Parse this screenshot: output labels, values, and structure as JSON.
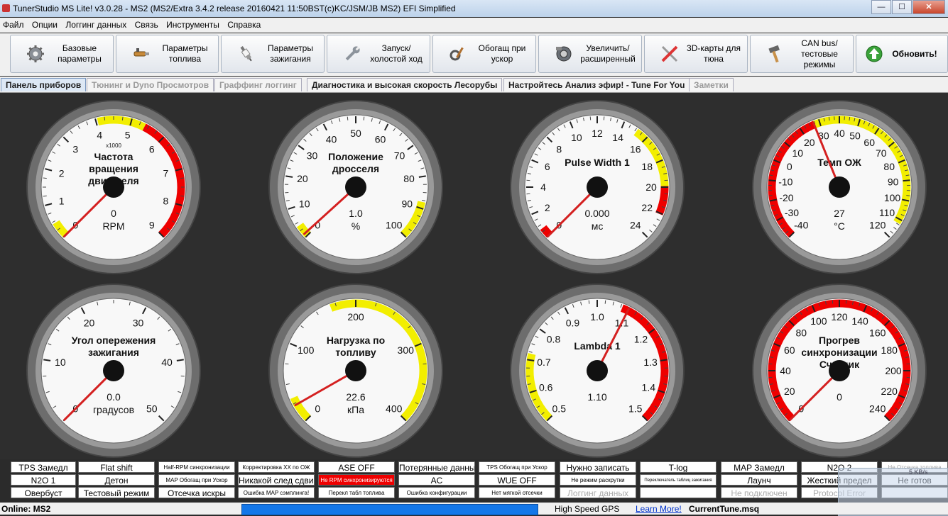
{
  "window": {
    "title": "TunerStudio MS Lite! v3.0.28 - MS2 (MS2/Extra 3.4.2 release  20160421 11:50BST(c)KC/JSM/JB   MS2) EFI Simplified",
    "min": "—",
    "max": "☐",
    "close": "✕"
  },
  "menu": [
    "Файл",
    "Опции",
    "Логгинг данных",
    "Связь",
    "Инструменты",
    "Справка"
  ],
  "toolbar": [
    {
      "label": "Базовые параметры",
      "icon": "gear-icon"
    },
    {
      "label": "Параметры топлива",
      "icon": "injector-icon"
    },
    {
      "label": "Параметры зажигания",
      "icon": "spark-plug-icon"
    },
    {
      "label": "Запуск/ холостой ход",
      "icon": "wrench-icon"
    },
    {
      "label": "Обогащ при ускор",
      "icon": "tools-icon"
    },
    {
      "label": "Увеличить/ расширенный",
      "icon": "turbo-icon"
    },
    {
      "label": "3D-карты для тюна",
      "icon": "screwdriver-icon"
    },
    {
      "label": "CAN bus/ тестовые режимы",
      "icon": "hammer-icon"
    },
    {
      "label": "Обновить!",
      "icon": "update-arrow-icon"
    }
  ],
  "tabs": [
    {
      "label": "Панель приборов",
      "state": "active"
    },
    {
      "label": "Тюнинг и Dyno Просмотров",
      "state": "dim"
    },
    {
      "label": "Граффинг логгинг",
      "state": "dim"
    },
    {
      "label": "Диагностика и высокая скорость Лесорубы",
      "state": "normal"
    },
    {
      "label": "Настройтесь Анализ эфир! - Tune For You",
      "state": "normal"
    },
    {
      "label": "Заметки",
      "state": "dim"
    }
  ],
  "gauges": [
    {
      "title": "Частота вращения двигателя",
      "value": "0",
      "units": "RPM",
      "mult": "x1000",
      "ticks": [
        "0",
        "1",
        "2",
        "3",
        "4",
        "5",
        "6",
        "7",
        "8",
        "9"
      ],
      "min": 0,
      "max": 9,
      "needle": 0
    },
    {
      "title": "Положение дросселя",
      "value": "1.0",
      "units": "%",
      "mult": "",
      "ticks": [
        "0",
        "10",
        "20",
        "30",
        "40",
        "50",
        "60",
        "70",
        "80",
        "90",
        "100"
      ],
      "min": 0,
      "max": 100,
      "needle": 1.0
    },
    {
      "title": "Pulse Width 1",
      "value": "0.000",
      "units": "мс",
      "mult": "",
      "ticks": [
        "0",
        "2",
        "4",
        "6",
        "8",
        "10",
        "12",
        "14",
        "16",
        "18",
        "20",
        "22",
        "24"
      ],
      "min": 0,
      "max": 24,
      "needle": 0
    },
    {
      "title": "Темп ОЖ",
      "value": "27",
      "units": "°C",
      "mult": "",
      "ticks": [
        "-40",
        "-30",
        "-20",
        "-10",
        "0",
        "10",
        "20",
        "30",
        "40",
        "50",
        "60",
        "70",
        "80",
        "90",
        "100",
        "110",
        "120"
      ],
      "min": -40,
      "max": 120,
      "needle": 27
    },
    {
      "title": "Угол опережения зажигания",
      "value": "0.0",
      "units": "градусов",
      "mult": "",
      "ticks": [
        "0",
        "10",
        "20",
        "30",
        "40",
        "50"
      ],
      "min": 0,
      "max": 50,
      "needle": 0
    },
    {
      "title": "Нагрузка по топливу",
      "value": "22.6",
      "units": "кПа",
      "mult": "",
      "ticks": [
        "0",
        "100",
        "200",
        "300",
        "400"
      ],
      "min": 0,
      "max": 400,
      "needle": 22.6
    },
    {
      "title": "Lambda 1",
      "value": "1.10",
      "units": "",
      "mult": "",
      "ticks": [
        "0.5",
        "0.6",
        "0.7",
        "0.8",
        "0.9",
        "1.0",
        "1.1",
        "1.2",
        "1.3",
        "1.4",
        "1.5"
      ],
      "min": 0.5,
      "max": 1.5,
      "needle": 1.1
    },
    {
      "title": "Прогрев синхронизации Счетчик",
      "value": "0",
      "units": "",
      "mult": "",
      "ticks": [
        "0",
        "20",
        "40",
        "60",
        "80",
        "100",
        "120",
        "140",
        "160",
        "180",
        "200",
        "220",
        "240"
      ],
      "min": 0,
      "max": 240,
      "needle": 0
    }
  ],
  "indicator_rows": [
    [
      {
        "label": "TPS Замедл",
        "style": "normal"
      },
      {
        "label": "Flat shift",
        "style": "normal"
      },
      {
        "label": "Half-RPM синхронизации",
        "style": "small"
      },
      {
        "label": "Корректировка ХХ по ОЖ",
        "style": "small"
      },
      {
        "label": "ASE OFF",
        "style": "normal"
      },
      {
        "label": "Потерянные данные",
        "style": "normal"
      },
      {
        "label": "TPS Обогащ при Ускор",
        "style": "small"
      },
      {
        "label": "Нужно записать",
        "style": "normal"
      },
      {
        "label": "T-log",
        "style": "normal"
      },
      {
        "label": "MAP Замедл",
        "style": "normal"
      },
      {
        "label": "N2O 2",
        "style": "normal"
      },
      {
        "label": "Не Отсечка топлива",
        "style": "small-dim"
      }
    ],
    [
      {
        "label": "N2O 1",
        "style": "normal"
      },
      {
        "label": "Детон",
        "style": "normal"
      },
      {
        "label": "MAP Обогащ при Ускор",
        "style": "small"
      },
      {
        "label": "Никакой след сдвиг",
        "style": "normal"
      },
      {
        "label": "Не RPM синхронизируются",
        "style": "small-red"
      },
      {
        "label": "AC",
        "style": "normal"
      },
      {
        "label": "WUE OFF",
        "style": "normal"
      },
      {
        "label": "Не режим раскрутки",
        "style": "small"
      },
      {
        "label": "Переключатель таблиц зажигания",
        "style": "tiny"
      },
      {
        "label": "Лаунч",
        "style": "normal"
      },
      {
        "label": "Жесткий предел",
        "style": "normal"
      },
      {
        "label": "Не готов",
        "style": "normal"
      }
    ],
    [
      {
        "label": "Овербуст",
        "style": "normal"
      },
      {
        "label": "Тестовый режим",
        "style": "normal"
      },
      {
        "label": "Отсечка искры",
        "style": "normal"
      },
      {
        "label": "Ошибка MAP сэмплинга!",
        "style": "small"
      },
      {
        "label": "Перекл табл топлива",
        "style": "small"
      },
      {
        "label": "Ошибка конфигурации",
        "style": "small"
      },
      {
        "label": "Нет мягкой отсечки",
        "style": "small"
      },
      {
        "label": "Логгинг данных",
        "style": "dim"
      },
      {
        "label": "",
        "style": "normal"
      },
      {
        "label": "Не подключен",
        "style": "dim"
      },
      {
        "label": "Protocol Error",
        "style": "dim"
      },
      {
        "label": "",
        "style": "normal"
      }
    ]
  ],
  "status": {
    "online": "Online: MS2",
    "gps": "High Speed GPS",
    "learn": "Learn More!",
    "file": "CurrentTune.msq",
    "rate": "5 KB/s"
  },
  "colors": {
    "red_zone": "#ee0000",
    "yellow_zone": "#f2ee00",
    "needle": "#d42020",
    "dash_bg": "#2e2e2e",
    "progress": "#1477e8"
  }
}
